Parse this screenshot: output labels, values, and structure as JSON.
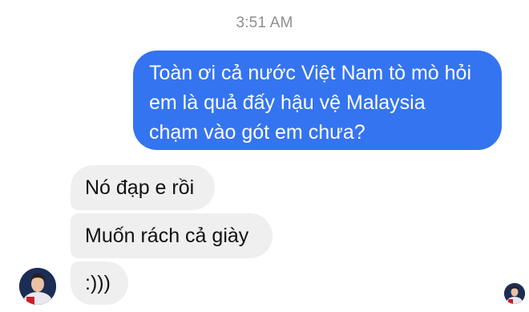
{
  "timestamp": "3:51 AM",
  "outgoing": {
    "lines": [
      "Toàn ơi cả nước Việt Nam tò mò hỏi",
      "em là quả đấy hậu vệ Malaysia",
      "chạm vào gót em chưa?"
    ],
    "color": "#3474f0"
  },
  "incoming": [
    {
      "text": "Nó đạp e rồi"
    },
    {
      "text": "Muốn rách cả giày"
    },
    {
      "text": ":)))"
    }
  ],
  "colors": {
    "incoming_bubble": "#efefef",
    "timestamp": "#8e8e93"
  },
  "icons": {
    "sender_avatar": "avatar-player-photo",
    "read_receipt": "seen-avatar-icon"
  }
}
